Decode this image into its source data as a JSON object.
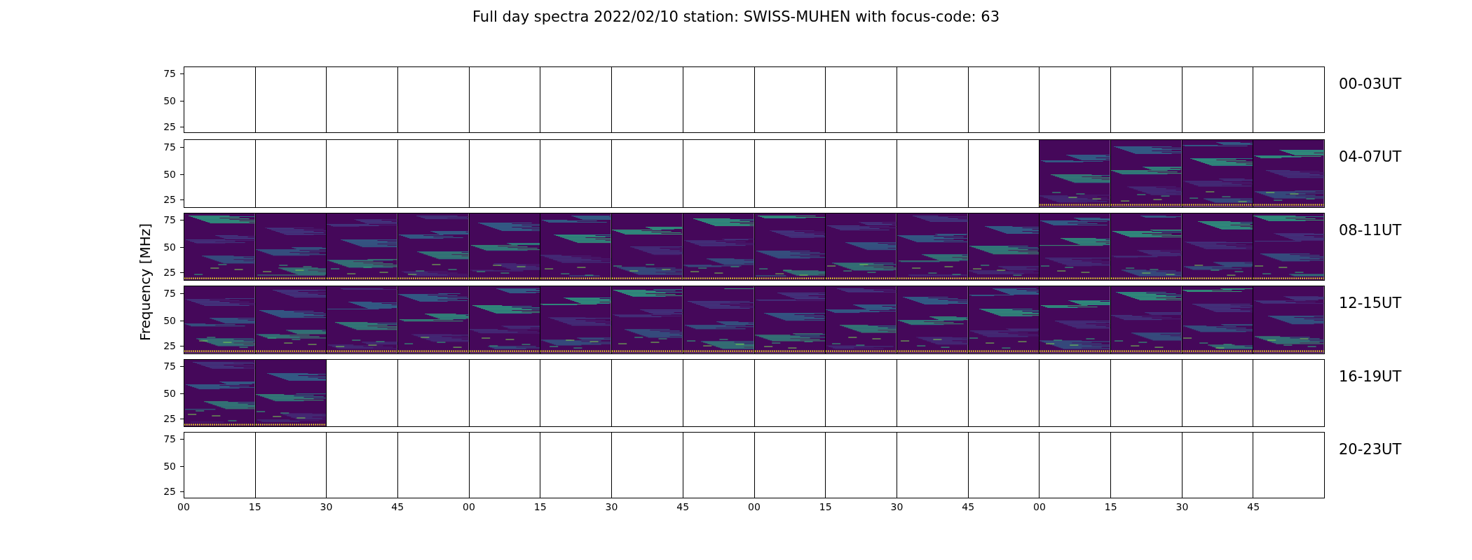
{
  "title": "Full day spectra 2022/02/10 station: SWISS-MUHEN with focus-code: 63",
  "y_axis_label": "Frequency [MHz]",
  "rows": [
    {
      "label": "00-03UT",
      "y_ticks": [
        "75",
        "50",
        "25"
      ],
      "panels": [
        {
          "has_data": false
        },
        {
          "has_data": false
        },
        {
          "has_data": false
        },
        {
          "has_data": false
        },
        {
          "has_data": false
        },
        {
          "has_data": false
        },
        {
          "has_data": false
        },
        {
          "has_data": false
        },
        {
          "has_data": false
        },
        {
          "has_data": false
        },
        {
          "has_data": false
        },
        {
          "has_data": false
        },
        {
          "has_data": false
        },
        {
          "has_data": false
        },
        {
          "has_data": false
        },
        {
          "has_data": false
        }
      ]
    },
    {
      "label": "04-07UT",
      "y_ticks": [
        "75",
        "50",
        "25"
      ],
      "panels": [
        {
          "has_data": false
        },
        {
          "has_data": false
        },
        {
          "has_data": false
        },
        {
          "has_data": false
        },
        {
          "has_data": false
        },
        {
          "has_data": false
        },
        {
          "has_data": false
        },
        {
          "has_data": false
        },
        {
          "has_data": false
        },
        {
          "has_data": false
        },
        {
          "has_data": false
        },
        {
          "has_data": false
        },
        {
          "has_data": true
        },
        {
          "has_data": true
        },
        {
          "has_data": true
        },
        {
          "has_data": true
        }
      ]
    },
    {
      "label": "08-11UT",
      "y_ticks": [
        "75",
        "50",
        "25"
      ],
      "panels": [
        {
          "has_data": true
        },
        {
          "has_data": true
        },
        {
          "has_data": true
        },
        {
          "has_data": true
        },
        {
          "has_data": true
        },
        {
          "has_data": true
        },
        {
          "has_data": true
        },
        {
          "has_data": true
        },
        {
          "has_data": true
        },
        {
          "has_data": true
        },
        {
          "has_data": true
        },
        {
          "has_data": true
        },
        {
          "has_data": true
        },
        {
          "has_data": true
        },
        {
          "has_data": true
        },
        {
          "has_data": true
        }
      ]
    },
    {
      "label": "12-15UT",
      "y_ticks": [
        "75",
        "50",
        "25"
      ],
      "panels": [
        {
          "has_data": true
        },
        {
          "has_data": true
        },
        {
          "has_data": true
        },
        {
          "has_data": true
        },
        {
          "has_data": true
        },
        {
          "has_data": true
        },
        {
          "has_data": true
        },
        {
          "has_data": true
        },
        {
          "has_data": true
        },
        {
          "has_data": true
        },
        {
          "has_data": true
        },
        {
          "has_data": true
        },
        {
          "has_data": true
        },
        {
          "has_data": true
        },
        {
          "has_data": true
        },
        {
          "has_data": true
        }
      ]
    },
    {
      "label": "16-19UT",
      "y_ticks": [
        "75",
        "50",
        "25"
      ],
      "panels": [
        {
          "has_data": true
        },
        {
          "has_data": true
        },
        {
          "has_data": false
        },
        {
          "has_data": false
        },
        {
          "has_data": false
        },
        {
          "has_data": false
        },
        {
          "has_data": false
        },
        {
          "has_data": false
        },
        {
          "has_data": false
        },
        {
          "has_data": false
        },
        {
          "has_data": false
        },
        {
          "has_data": false
        },
        {
          "has_data": false
        },
        {
          "has_data": false
        },
        {
          "has_data": false
        },
        {
          "has_data": false
        }
      ]
    },
    {
      "label": "20-23UT",
      "y_ticks": [
        "75",
        "50",
        "25"
      ],
      "panels": [
        {
          "has_data": false
        },
        {
          "has_data": false
        },
        {
          "has_data": false
        },
        {
          "has_data": false
        },
        {
          "has_data": false
        },
        {
          "has_data": false
        },
        {
          "has_data": false
        },
        {
          "has_data": false
        },
        {
          "has_data": false
        },
        {
          "has_data": false
        },
        {
          "has_data": false
        },
        {
          "has_data": false
        },
        {
          "has_data": false
        },
        {
          "has_data": false
        },
        {
          "has_data": false
        },
        {
          "has_data": false
        }
      ]
    }
  ],
  "x_ticks": [
    "00",
    "15",
    "30",
    "45",
    "00",
    "15",
    "30",
    "45",
    "00",
    "15",
    "30",
    "45",
    "00",
    "15",
    "30",
    "45"
  ]
}
